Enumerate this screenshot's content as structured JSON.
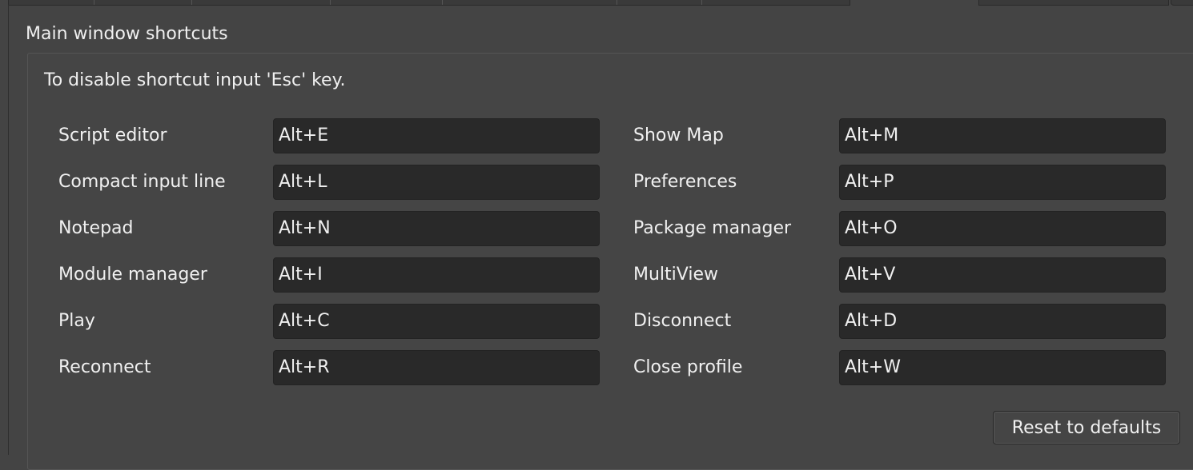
{
  "section_title": "Main window shortcuts",
  "hint": "To disable shortcut input 'Esc' key.",
  "shortcuts": [
    {
      "label": "Script editor",
      "value": "Alt+E"
    },
    {
      "label": "Compact input line",
      "value": "Alt+L"
    },
    {
      "label": "Notepad",
      "value": "Alt+N"
    },
    {
      "label": "Module manager",
      "value": "Alt+I"
    },
    {
      "label": "Play",
      "value": "Alt+C"
    },
    {
      "label": "Reconnect",
      "value": "Alt+R"
    },
    {
      "label": "Show Map",
      "value": "Alt+M"
    },
    {
      "label": "Preferences",
      "value": "Alt+P"
    },
    {
      "label": "Package manager",
      "value": "Alt+O"
    },
    {
      "label": "MultiView",
      "value": "Alt+V"
    },
    {
      "label": "Disconnect",
      "value": "Alt+D"
    },
    {
      "label": "Close profile",
      "value": "Alt+W"
    }
  ],
  "reset_button": "Reset to defaults"
}
